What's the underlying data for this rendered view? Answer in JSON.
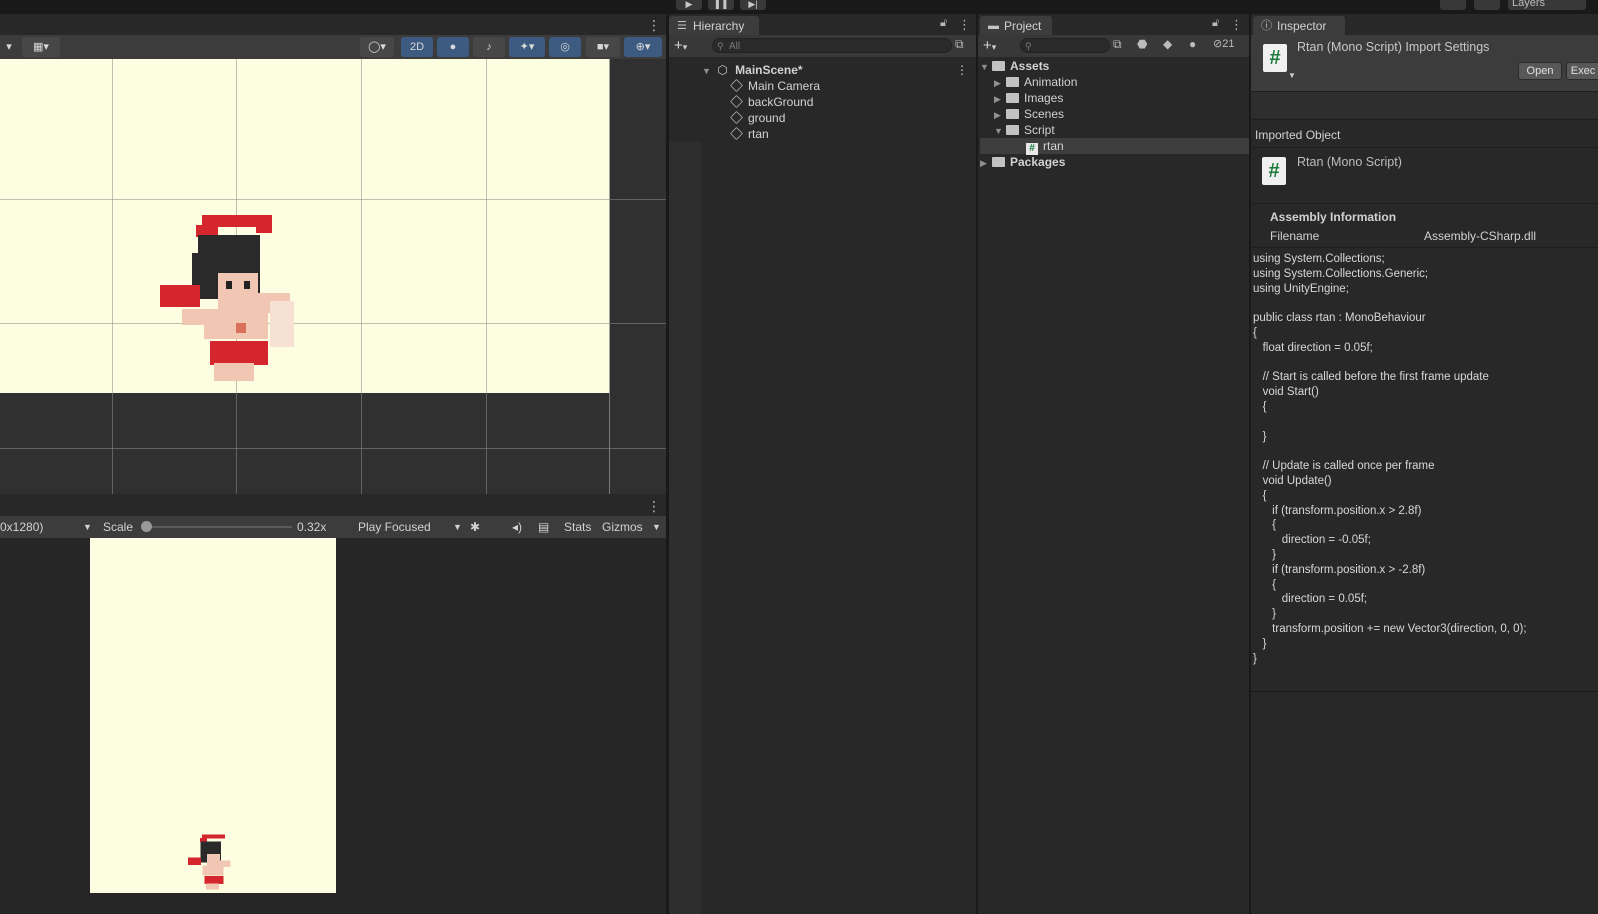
{
  "topbar": {
    "play": "▶",
    "pause": "❚❚",
    "step": "▶|",
    "layers": "Layers"
  },
  "scene": {
    "toolbar": {
      "mode_2d": "2D"
    }
  },
  "game": {
    "resolution": "0x1280)",
    "scale_label": "Scale",
    "scale_value": "0.32x",
    "play_mode": "Play Focused",
    "stats": "Stats",
    "gizmos": "Gizmos"
  },
  "hierarchy": {
    "tab": "Hierarchy",
    "search_placeholder": "All",
    "scene_name": "MainScene*",
    "items": [
      "Main Camera",
      "backGround",
      "ground",
      "rtan"
    ]
  },
  "project": {
    "tab": "Project",
    "hidden_count": "21",
    "tree": [
      {
        "label": "Assets",
        "bold": true
      },
      {
        "label": "Animation"
      },
      {
        "label": "Images"
      },
      {
        "label": "Scenes"
      },
      {
        "label": "Script"
      },
      {
        "label": "rtan"
      },
      {
        "label": "Packages",
        "bold": true
      }
    ]
  },
  "inspector": {
    "tab": "Inspector",
    "title": "Rtan (Mono Script) Import Settings",
    "open_button": "Open",
    "exec_button": "Exec",
    "imported_object_label": "Imported Object",
    "object_name": "Rtan (Mono Script)",
    "assembly_info_title": "Assembly Information",
    "filename_label": "Filename",
    "filename_value": "Assembly-CSharp.dll",
    "code": "using System.Collections;\nusing System.Collections.Generic;\nusing UnityEngine;\n\npublic class rtan : MonoBehaviour\n{\n   float direction = 0.05f;\n\n   // Start is called before the first frame update\n   void Start()\n   {\n\n   }\n\n   // Update is called once per frame\n   void Update()\n   {\n      if (transform.position.x > 2.8f)\n      {\n         direction = -0.05f;\n      }\n      if (transform.position.x > -2.8f)\n      {\n         direction = 0.05f;\n      }\n      transform.position += new Vector3(direction, 0, 0);\n   }\n}"
  },
  "colors": {
    "scene_background": "#fdfde1",
    "panel": "#282828",
    "toolbar": "#3c3c3c",
    "active_toggle": "#3d5a80",
    "script_icon_green": "#1d7a3c",
    "character_red": "#d4262c"
  }
}
